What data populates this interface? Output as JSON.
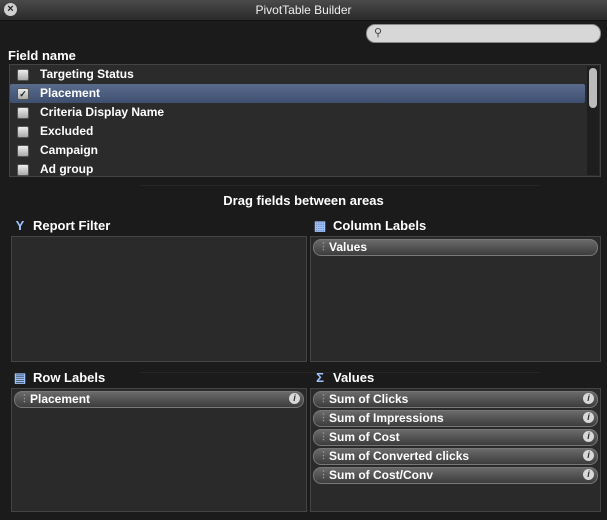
{
  "window": {
    "title": "PivotTable Builder"
  },
  "search": {
    "placeholder": "",
    "value": ""
  },
  "field_list": {
    "header": "Field name",
    "fields": [
      {
        "label": "Targeting Status",
        "checked": false
      },
      {
        "label": "Placement",
        "checked": true
      },
      {
        "label": "Criteria Display Name",
        "checked": false
      },
      {
        "label": "Excluded",
        "checked": false
      },
      {
        "label": "Campaign",
        "checked": false
      },
      {
        "label": "Ad group",
        "checked": false
      }
    ]
  },
  "drag_hint": "Drag fields between areas",
  "areas": {
    "report_filter": {
      "title": "Report Filter",
      "items": []
    },
    "column_labels": {
      "title": "Column Labels",
      "items": [
        "Values"
      ]
    },
    "row_labels": {
      "title": "Row Labels",
      "items": [
        "Placement"
      ]
    },
    "values": {
      "title": "Values",
      "items": [
        "Sum of Clicks",
        "Sum of Impressions",
        "Sum of Cost",
        "Sum of Converted clicks",
        "Sum of Cost/Conv"
      ]
    }
  },
  "icons": {
    "close": "close-icon",
    "search": "search-icon",
    "filter": "filter-icon",
    "column": "column-labels-icon",
    "row": "row-labels-icon",
    "sigma": "sigma-icon",
    "info": "info-icon"
  },
  "colors": {
    "selection": "#4a5c80",
    "background": "#1b1b1b",
    "pill": "#555555"
  }
}
